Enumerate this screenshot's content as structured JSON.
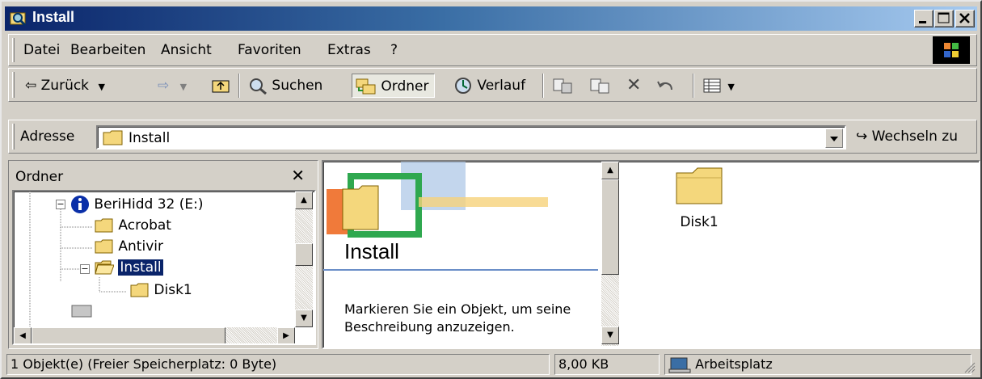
{
  "window": {
    "title": "Install"
  },
  "menu": {
    "items": [
      "Datei",
      "Bearbeiten",
      "Ansicht",
      "Favoriten",
      "Extras",
      "?"
    ]
  },
  "toolbar": {
    "back": "Zurück",
    "search": "Suchen",
    "folders": "Ordner",
    "history": "Verlauf"
  },
  "address": {
    "label": "Adresse",
    "value": "Install",
    "go": "Wechseln zu"
  },
  "folder_pane": {
    "header": "Ordner",
    "items": [
      {
        "label": "BeriHidd 32 (E:)"
      },
      {
        "label": "Acrobat"
      },
      {
        "label": "Antivir"
      },
      {
        "label": "Install",
        "selected": true
      },
      {
        "label": "Disk1"
      }
    ]
  },
  "webview": {
    "title": "Install",
    "description": "Markieren Sie ein Objekt, um seine Beschreibung anzuzeigen."
  },
  "files": [
    {
      "name": "Disk1",
      "icon": "folder-icon"
    }
  ],
  "status": {
    "objects": "1 Objekt(e)  (Freier Speicherplatz: 0 Byte)",
    "size": "8,00 KB",
    "zone": "Arbeitsplatz"
  },
  "colors": {
    "title_gradient_start": "#0a246a",
    "title_gradient_end": "#a6caf0",
    "selection": "#0a246a",
    "folder": "#f4d77c"
  }
}
